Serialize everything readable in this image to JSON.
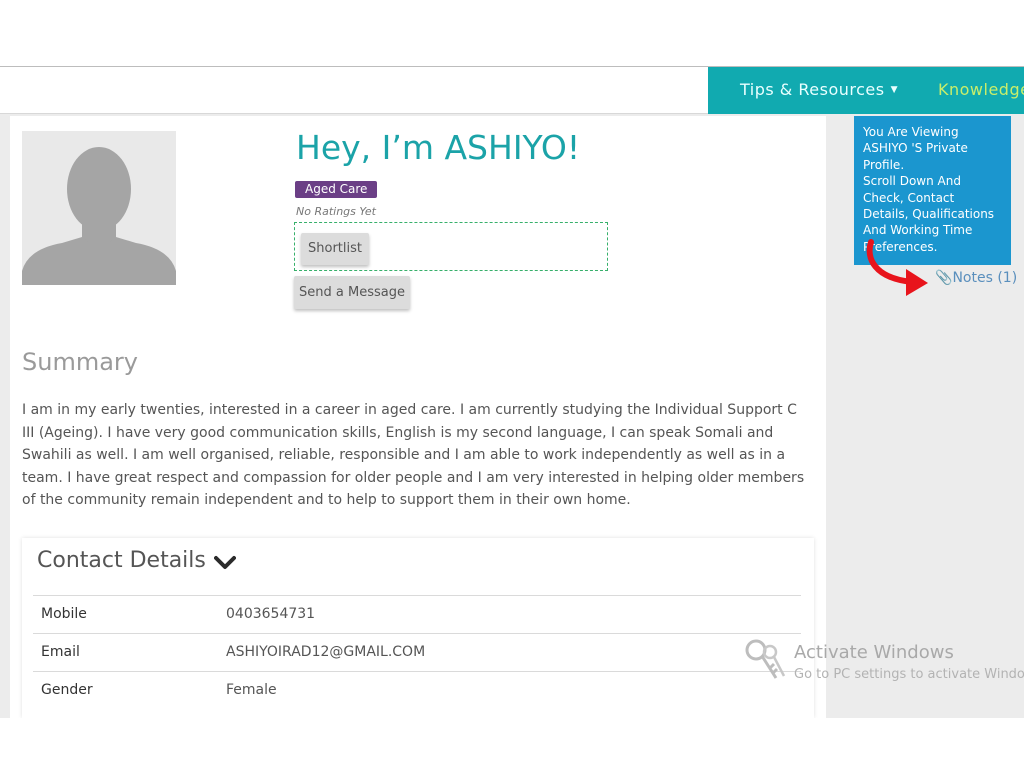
{
  "nav": {
    "tips_label": "Tips & Resources",
    "knowledge_label": "Knowledge"
  },
  "profile": {
    "greeting": "Hey, I’m ASHIYO!",
    "badge": "Aged Care",
    "ratings": "No Ratings Yet",
    "shortlist_label": "Shortlist",
    "message_label": "Send a Message"
  },
  "summary": {
    "title": "Summary",
    "text": "I am in my early twenties, interested in a career in aged care. I am currently studying the Individual Support C III (Ageing). I have very good communication skills, English is my second language, I can speak Somali and Swahili as well. I am well organised, reliable, responsible and I am able to work independently as well as in a team. I have great respect and compassion for older people and I am very interested in helping older members of the community remain independent and to help to support them in their own home."
  },
  "contact": {
    "title": "Contact Details",
    "rows": [
      {
        "label": "Mobile",
        "value": "0403654731"
      },
      {
        "label": "Email",
        "value": "ASHIYOIRAD12@GMAIL.COM"
      },
      {
        "label": "Gender",
        "value": "Female"
      }
    ]
  },
  "tooltip": {
    "lines": [
      "You Are Viewing",
      "ASHIYO 'S Private",
      "Profile.",
      "Scroll Down And",
      "Check, Contact",
      "Details, Qualifications",
      "And Working Time",
      "Preferences."
    ]
  },
  "notes": {
    "label": "Notes (1)"
  },
  "watermark": {
    "title": "Activate Windows",
    "subtitle": "Go to PC settings to activate Windows."
  },
  "colors": {
    "teal_nav": "#11aab0",
    "greeting": "#1ba3a8",
    "badge": "#6b3f86",
    "tooltip": "#1b96cf",
    "arrow": "#e8141c",
    "knowledge": "#c9ee6a"
  },
  "icons": {
    "tips_caret": "caret-down-icon",
    "contact_toggle": "chevron-down-icon",
    "notes": "paperclip-icon",
    "watermark": "key-icon"
  }
}
